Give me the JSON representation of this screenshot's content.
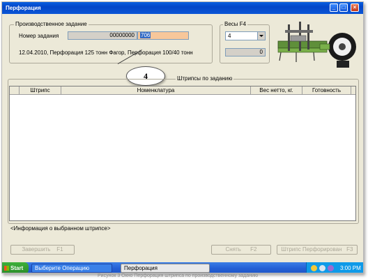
{
  "window": {
    "title": "Перфорация"
  },
  "production_task": {
    "group_label": "Производственное задание",
    "task_number_label": "Номер задания",
    "task_number_prefix": "00000000",
    "task_number_input": "706",
    "description": "12.04.2010, Перфорация 125 тонн Фагор, Перфорация 100/40 тонн"
  },
  "scales": {
    "group_label": "Весы  F4",
    "selected": "4",
    "weight_value": "0"
  },
  "callout": {
    "label": "4"
  },
  "barcodes": {
    "group_label": "Штрипсы по заданию",
    "columns": [
      "Штрипс",
      "Номенклатура",
      "Вес нетто, кг.",
      "Готовность"
    ],
    "rows": []
  },
  "info_text": "<Информация о выбранном штрипсе>",
  "buttons": {
    "complete": "Завершить",
    "complete_key": "F1",
    "remove": "Снять",
    "remove_key": "F2",
    "perforated": "Штрипс Перфорирован",
    "perforated_key": "F3"
  },
  "taskbar": {
    "start_label": "Start",
    "items": [
      "Выберите Операцию",
      "Перфорация"
    ],
    "time": "3:00 PM"
  },
  "footer_text": "Рисунок 3 Окно Перфорация штрипса по производственному заданию"
}
